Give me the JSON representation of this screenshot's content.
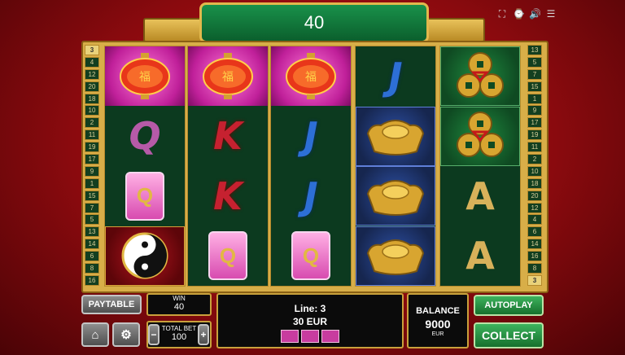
{
  "header": {
    "win_amount": "40"
  },
  "top_icons": [
    "fullscreen-icon",
    "history-icon",
    "sound-icon",
    "menu-icon"
  ],
  "paylines": {
    "left": [
      "3",
      "4",
      "12",
      "20",
      "18",
      "10",
      "2",
      "11",
      "19",
      "17",
      "9",
      "1",
      "15",
      "7",
      "5",
      "13",
      "14",
      "6",
      "8",
      "16"
    ],
    "right": [
      "13",
      "5",
      "7",
      "15",
      "1",
      "9",
      "17",
      "19",
      "11",
      "2",
      "10",
      "18",
      "20",
      "12",
      "4",
      "6",
      "14",
      "16",
      "8",
      "3"
    ]
  },
  "reels": [
    [
      {
        "sym": "lantern"
      },
      {
        "sym": "Q"
      },
      {
        "sym": "Q-tile"
      },
      {
        "sym": "yin-yang"
      }
    ],
    [
      {
        "sym": "lantern"
      },
      {
        "sym": "K"
      },
      {
        "sym": "K"
      },
      {
        "sym": "Q-tile"
      }
    ],
    [
      {
        "sym": "lantern"
      },
      {
        "sym": "J"
      },
      {
        "sym": "J"
      },
      {
        "sym": "Q-tile"
      }
    ],
    [
      {
        "sym": "J"
      },
      {
        "sym": "gold-ingot"
      },
      {
        "sym": "gold-ingot"
      },
      {
        "sym": "gold-ingot"
      }
    ],
    [
      {
        "sym": "coins"
      },
      {
        "sym": "coins"
      },
      {
        "sym": "A"
      },
      {
        "sym": "A"
      }
    ]
  ],
  "controls": {
    "paytable_label": "PAYTABLE",
    "win_label": "WIN",
    "win_value": "40",
    "total_bet_label": "TOTAL BET",
    "total_bet_value": "100",
    "minus": "−",
    "plus": "+",
    "info_line": "Line: 3",
    "info_amount": "30 EUR",
    "balance_label": "BALANCE",
    "balance_value": "9000",
    "currency": "EUR",
    "autoplay_label": "AUTOPLAY",
    "collect_label": "COLLECT",
    "home_icon": "home-icon",
    "settings_icon": "settings-icon"
  }
}
